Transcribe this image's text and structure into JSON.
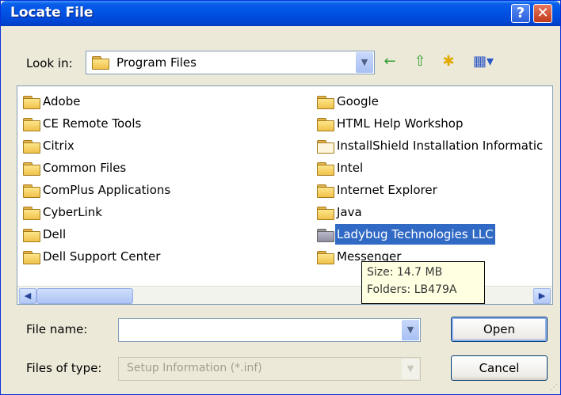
{
  "window": {
    "title": "Locate File",
    "help_glyph": "?",
    "close_glyph": "✕"
  },
  "toolbar": {
    "lookin_label": "Look in:",
    "lookin_value": "Program Files",
    "back_icon": "←",
    "up_icon": "⇧",
    "newfolder_icon": "✱",
    "views_icon": "▦▾"
  },
  "folders_left": [
    "Adobe",
    "CE Remote Tools",
    "Citrix",
    "Common Files",
    "ComPlus Applications",
    "CyberLink",
    "Dell",
    "Dell Support Center"
  ],
  "folders_right": [
    "Google",
    "HTML Help Workshop",
    "InstallShield Installation Informatic",
    "Intel",
    "Internet Explorer",
    "Java",
    "Ladybug Technologies LLC",
    "Messenger"
  ],
  "tooltip": {
    "size": "Size: 14.7 MB",
    "folders": "Folders: LB479A"
  },
  "bottom": {
    "filename_label": "File name:",
    "filename_value": "",
    "filetype_label": "Files of type:",
    "filetype_value": "Setup Information (*.inf)",
    "open_label": "Open",
    "cancel_label": "Cancel"
  },
  "colors": {
    "title_bar": "#0055e5",
    "selection": "#316ac5",
    "dialog_bg": "#ece9d8"
  }
}
